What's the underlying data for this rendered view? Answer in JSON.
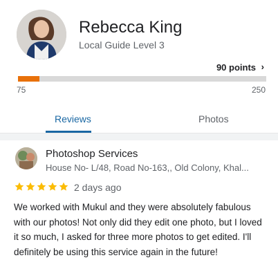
{
  "profile": {
    "name": "Rebecca King",
    "level": "Local Guide Level 3",
    "points_label": "90 points",
    "progress": {
      "min_label": "75",
      "max_label": "250",
      "current": 90,
      "min": 75,
      "max": 250,
      "fill_color": "#e8710a",
      "track_color": "#d9d9d9"
    }
  },
  "tabs": [
    {
      "label": "Reviews",
      "selected": true
    },
    {
      "label": "Photos",
      "selected": false
    }
  ],
  "review": {
    "place_name": "Photoshop Services",
    "address": "House No- L/48, Road No-163,, Old Colony, Khal...",
    "rating": 5,
    "time": "2 days ago",
    "text": "We worked with Mukul and they were absolutely fabulous with our photos! Not only did they edit one photo, but I loved it so much, I asked for three more photos to get edited. I'll definitely be using this service again in the future!",
    "star_color": "#fbbc04"
  },
  "colors": {
    "accent": "#1967a3",
    "text_primary": "#202124",
    "text_secondary": "#5f6368"
  }
}
